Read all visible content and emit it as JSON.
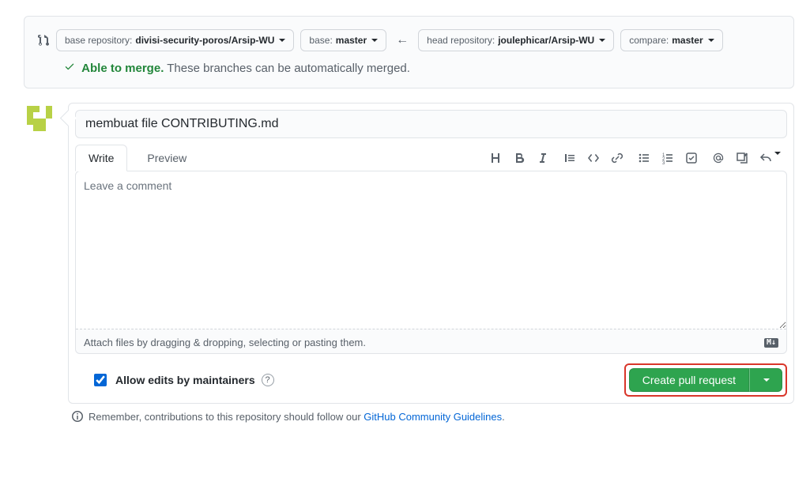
{
  "compare": {
    "base_label": "base repository: ",
    "base_value": "divisi-security-poros/Arsip-WU",
    "base_branch_label": "base: ",
    "base_branch_value": "master",
    "head_label": "head repository: ",
    "head_value": "joulephicar/Arsip-WU",
    "compare_label": "compare: ",
    "compare_value": "master"
  },
  "merge": {
    "status": "Able to merge.",
    "detail": "These branches can be automatically merged."
  },
  "tabs": {
    "write": "Write",
    "preview": "Preview"
  },
  "form": {
    "title": "membuat file CONTRIBUTING.md",
    "placeholder": "Leave a comment",
    "attach_hint": "Attach files by dragging & dropping, selecting or pasting them."
  },
  "footer": {
    "allow_edits": "Allow edits by maintainers",
    "create_label": "Create pull request"
  },
  "guidelines": {
    "prefix": "Remember, contributions to this repository should follow our ",
    "link": "GitHub Community Guidelines",
    "suffix": "."
  }
}
